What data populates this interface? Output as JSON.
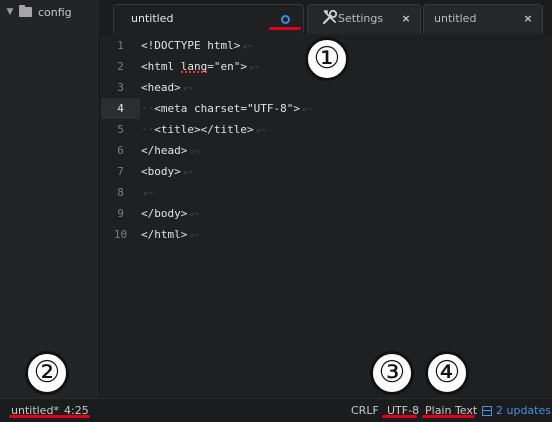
{
  "sidebar": {
    "tree_root": {
      "label": "config",
      "icon": "folder-icon",
      "chevron": "chevron-down-icon"
    }
  },
  "tabs": [
    {
      "label": "untitled",
      "active": true,
      "modified": true,
      "icon": "modified-dot-icon"
    },
    {
      "label": "Settings",
      "active": false,
      "icon": "tools-icon",
      "close": "×"
    },
    {
      "label": "untitled",
      "active": false,
      "close": "×"
    }
  ],
  "editor": {
    "current_line": 4,
    "lines": [
      {
        "n": "1",
        "code": "<!DOCTYPE html>",
        "indent": ""
      },
      {
        "n": "2",
        "code": "<html lang=\"en\">",
        "indent": ""
      },
      {
        "n": "3",
        "code": "<head>",
        "indent": ""
      },
      {
        "n": "4",
        "code": "<meta charset=\"UTF-8\">",
        "indent": "··"
      },
      {
        "n": "5",
        "code": "<title></title>",
        "indent": "··"
      },
      {
        "n": "6",
        "code": "</head>",
        "indent": ""
      },
      {
        "n": "7",
        "code": "<body>",
        "indent": ""
      },
      {
        "n": "8",
        "code": "",
        "indent": ""
      },
      {
        "n": "9",
        "code": "</body>",
        "indent": ""
      },
      {
        "n": "10",
        "code": "</html>",
        "indent": ""
      }
    ],
    "eol_marker": "¤¬"
  },
  "statusbar": {
    "file": "untitled*",
    "cursor": "4:25",
    "line_ending": "CRLF",
    "encoding": "UTF-8",
    "grammar": "Plain Text",
    "updates": "2 updates"
  },
  "annotations": {
    "callouts": [
      "①",
      "②",
      "③",
      "④"
    ],
    "mark_color": "#e0001a"
  },
  "colors": {
    "accent_blue": "#3a8fd6",
    "updates_blue": "#4b8ee6",
    "background": "#1f2022"
  }
}
